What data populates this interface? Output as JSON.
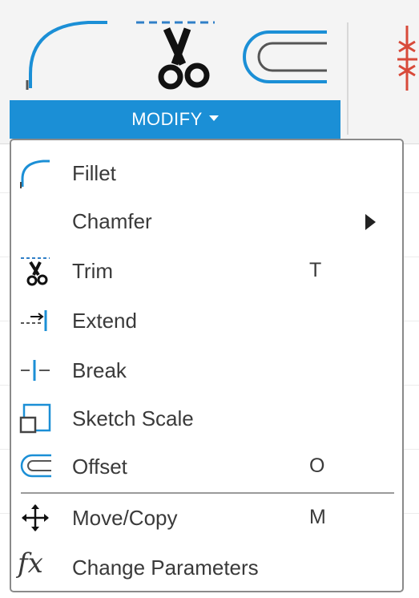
{
  "toolbar": {
    "group_label": "MODIFY",
    "tools": [
      {
        "icon": "fillet-icon"
      },
      {
        "icon": "trim-scissors-icon"
      },
      {
        "icon": "offset-icon"
      },
      {
        "icon": "mirror-icon-partial"
      }
    ],
    "accent_color": "#1b8fd6"
  },
  "menu": {
    "items": [
      {
        "label": "Fillet",
        "shortcut": "",
        "icon": "fillet-icon",
        "submenu": false
      },
      {
        "label": "Chamfer",
        "shortcut": "",
        "icon": "",
        "submenu": true
      },
      {
        "label": "Trim",
        "shortcut": "T",
        "icon": "trim-icon",
        "submenu": false
      },
      {
        "label": "Extend",
        "shortcut": "",
        "icon": "extend-icon",
        "submenu": false
      },
      {
        "label": "Break",
        "shortcut": "",
        "icon": "break-icon",
        "submenu": false
      },
      {
        "label": "Sketch Scale",
        "shortcut": "",
        "icon": "sketch-scale-icon",
        "submenu": false
      },
      {
        "label": "Offset",
        "shortcut": "O",
        "icon": "offset-icon",
        "submenu": false
      },
      {
        "label": "Move/Copy",
        "shortcut": "M",
        "icon": "move-copy-icon",
        "submenu": false
      },
      {
        "label": "Change Parameters",
        "shortcut": "",
        "icon": "fx-icon",
        "submenu": false
      }
    ]
  }
}
